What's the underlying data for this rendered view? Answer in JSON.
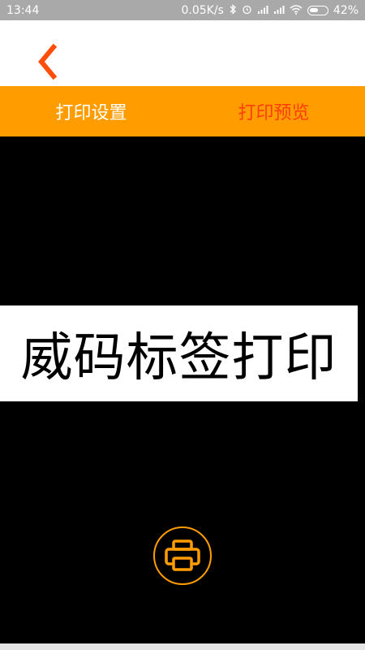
{
  "status_bar": {
    "time": "13:44",
    "network_speed": "0.05K/s",
    "battery_percent": "42%",
    "battery_level": 0.42,
    "icons": [
      "bluetooth-icon",
      "alarm-icon",
      "signal-icon",
      "signal-icon",
      "wifi-icon",
      "battery-icon"
    ]
  },
  "header": {
    "back_icon": "chevron-left-icon",
    "accent_color": "#ff4d0a"
  },
  "tabs": [
    {
      "label": "打印设置",
      "active": false,
      "color": "#ffffff"
    },
    {
      "label": "打印预览",
      "active": true,
      "color": "#ff3d0a"
    }
  ],
  "tab_bar_color": "#ff9d00",
  "preview": {
    "label_text": "威码标签打印"
  },
  "print_button": {
    "icon": "printer-icon",
    "color": "#ff9d00"
  }
}
